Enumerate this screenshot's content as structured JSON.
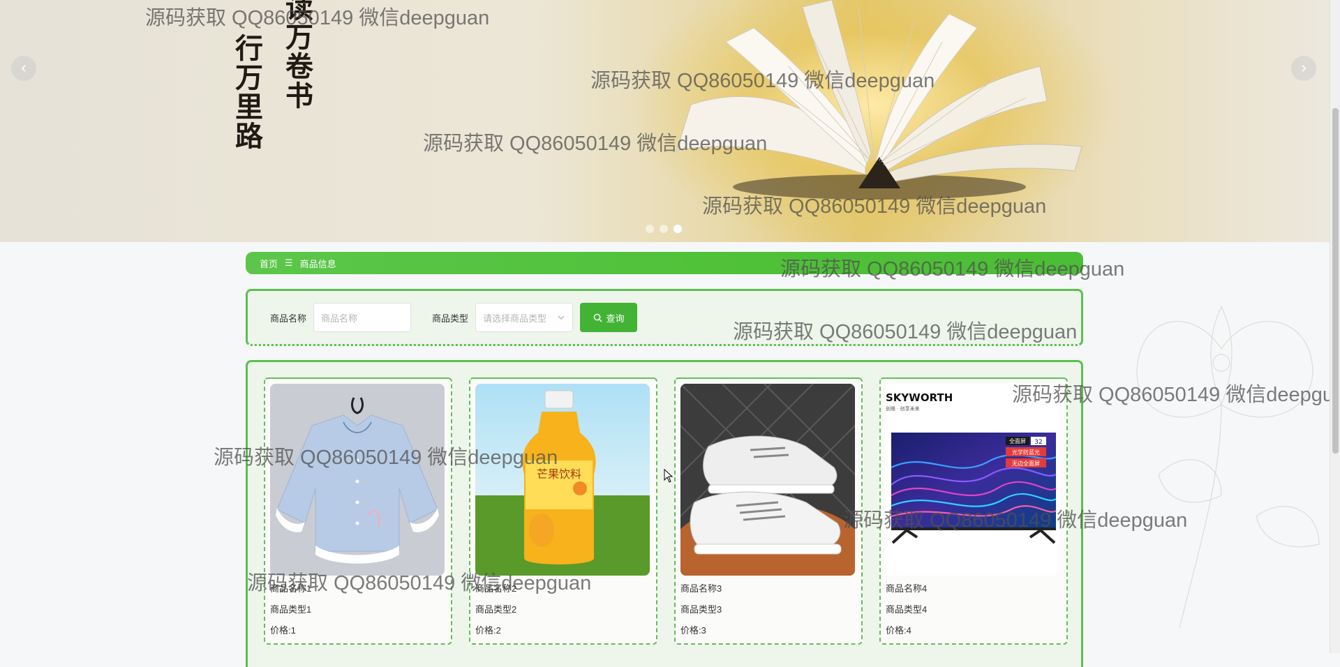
{
  "banner": {
    "calligraphy_col1": "读万卷书",
    "calligraphy_col2": "行万里路",
    "prev_arrow": "‹",
    "next_arrow": "›",
    "slide_count": 3,
    "active_slide": 3
  },
  "breadcrumb": {
    "home": "首页",
    "separator": "☰",
    "current": "商品信息"
  },
  "search": {
    "name_label": "商品名称",
    "name_placeholder": "商品名称",
    "type_label": "商品类型",
    "type_placeholder": "请选择商品类型",
    "button_label": "查询"
  },
  "products": [
    {
      "name": "商品名称1",
      "type": "商品类型1",
      "price": "价格:1",
      "image": "blouse"
    },
    {
      "name": "商品名称2",
      "type": "商品类型2",
      "price": "价格:2",
      "image": "juice-bottle"
    },
    {
      "name": "商品名称3",
      "type": "商品类型3",
      "price": "价格:3",
      "image": "sneakers"
    },
    {
      "name": "商品名称4",
      "type": "商品类型4",
      "price": "价格:4",
      "image": "television"
    }
  ],
  "tv_brand": {
    "name": "SKYWORTH",
    "slogan": "创维 · 创享未来"
  },
  "tv_tags": [
    "全面屏",
    "32",
    "光学防蓝光",
    "无边全面屏"
  ],
  "juice_label": "芒果饮料",
  "watermark": "源码获取 QQ86050149 微信deepguan",
  "colors": {
    "accent": "#4fc138",
    "button": "#42b335",
    "panel_bg": "#eef6ec",
    "border": "#5bbf4f"
  }
}
